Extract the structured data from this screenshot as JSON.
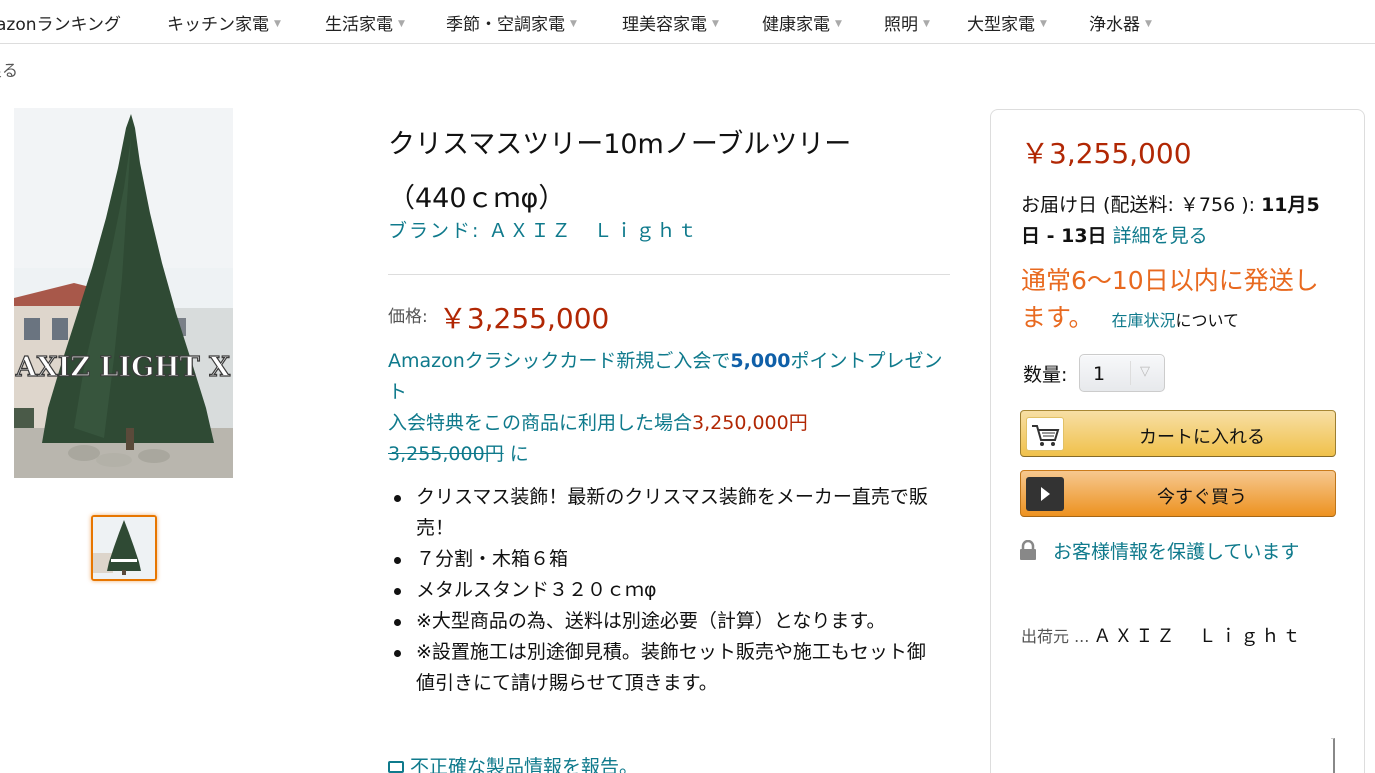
{
  "nav": {
    "items": [
      {
        "label": "azonランキング",
        "dropdown": false
      },
      {
        "label": "キッチン家電",
        "dropdown": true
      },
      {
        "label": "生活家電",
        "dropdown": true
      },
      {
        "label": "季節・空調家電",
        "dropdown": true
      },
      {
        "label": "理美容家電",
        "dropdown": true
      },
      {
        "label": "健康家電",
        "dropdown": true
      },
      {
        "label": "照明",
        "dropdown": true
      },
      {
        "label": "大型家電",
        "dropdown": true
      },
      {
        "label": "浄水器",
        "dropdown": true
      }
    ]
  },
  "back": {
    "label": "戻る"
  },
  "image": {
    "watermark": "AXIZ LIGHT X",
    "thumbnail_count": 1
  },
  "product": {
    "title_line1": "クリスマスツリー10mノーブルツリー",
    "title_line2": "（440ｃｍφ）",
    "brand": "ブランド: ＡＸＩＺ　Ｌｉｇｈｔ",
    "price_label": "価格:",
    "price": "￥3,255,000",
    "promo": {
      "line1_a": "Amazonクラシックカード新規ご入会で",
      "points": "5,000",
      "line1_b": "ポイントプレゼント",
      "line2_a": "入会特典をこの商品に利用した場合",
      "discounted": "3,250,000円",
      "original": "3,255,000円",
      "suffix": " に"
    },
    "bullets": [
      "クリスマス装飾！最新のクリスマス装飾をメーカー直売で販売！",
      "７分割・木箱６箱",
      "メタルスタンド３２０ｃｍφ",
      "※大型商品の為、送料は別途必要（計算）となります。",
      "※設置施工は別途御見積。装飾セット販売や施工もセット御値引きにて請け賜らせて頂きます。"
    ],
    "report": "不正確な製品情報を報告。"
  },
  "buybox": {
    "price": "￥3,255,000",
    "delivery_prefix": "お届け日 (配送料: ￥756 ): ",
    "delivery_dates": "11月5日 - 13日",
    "delivery_link": "詳細を見る",
    "ship_text": "通常6～10日以内に発送します。",
    "stock_link": "在庫状況",
    "stock_suffix": "について",
    "qty_label": "数量:",
    "qty_value": "1",
    "add_to_cart": "カートに入れる",
    "buy_now": "今すぐ買う",
    "secure": "お客様情報を保護しています",
    "seller_label": "出荷元 ...",
    "seller_name": "ＡＸＩＺ　Ｌｉｇｈｔ"
  },
  "colors": {
    "price": "#b12704",
    "link": "#0f7a8c",
    "shipping": "#e8691f",
    "cart_button": "#f0c14b",
    "buy_button": "#ed9220"
  },
  "icons": [
    "dropdown-caret-icon",
    "cart-icon",
    "play-icon",
    "lock-icon",
    "chevron-down-icon",
    "report-icon"
  ]
}
